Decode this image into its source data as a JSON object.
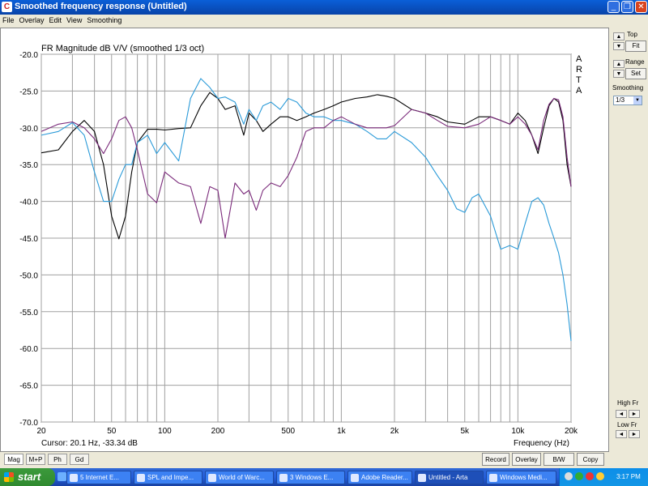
{
  "window": {
    "title": "Smoothed frequency response (Untitled)",
    "icon_glyph": "C",
    "controls": [
      "_",
      "❐",
      "✕"
    ]
  },
  "menu": [
    "File",
    "Overlay",
    "Edit",
    "View",
    "Smoothing"
  ],
  "chart_data": {
    "type": "line",
    "title": "FR Magnitude dB V/V (smoothed 1/3 oct)",
    "xlabel": "Frequency (Hz)",
    "ylabel": "",
    "x_scale": "log",
    "xlim": [
      20,
      20000
    ],
    "ylim": [
      -70,
      -20
    ],
    "y_ticks": [
      "-20.0",
      "-25.0",
      "-30.0",
      "-35.0",
      "-40.0",
      "-45.0",
      "-50.0",
      "-55.0",
      "-60.0",
      "-65.0",
      "-70.0"
    ],
    "x_ticks": [
      "20",
      "50",
      "100",
      "200",
      "500",
      "1k",
      "2k",
      "5k",
      "10k",
      "20k"
    ],
    "side_label": [
      "A",
      "R",
      "T",
      "A"
    ],
    "cursor_text": "Cursor: 20.1 Hz, -33.34 dB",
    "grid": true,
    "colors": {
      "series_black": "#000000",
      "series_blue": "#2a9ad8",
      "series_purple": "#7a2a7a",
      "grid": "#a0a0a0"
    },
    "series": [
      {
        "color": "#000000",
        "x": [
          20,
          25,
          30,
          35,
          40,
          45,
          50,
          55,
          60,
          65,
          70,
          80,
          90,
          100,
          120,
          140,
          160,
          180,
          200,
          220,
          250,
          280,
          300,
          330,
          360,
          400,
          450,
          500,
          560,
          630,
          700,
          800,
          900,
          1000,
          1200,
          1400,
          1600,
          1800,
          2000,
          2500,
          3000,
          3500,
          4000,
          5000,
          6000,
          7000,
          8000,
          9000,
          10000,
          11000,
          12000,
          13000,
          14000,
          15000,
          16000,
          17000,
          18000,
          19000,
          20000
        ],
        "y": [
          -33.4,
          -33,
          -30.5,
          -29,
          -30.5,
          -35,
          -42,
          -45.1,
          -42,
          -36,
          -32,
          -30.2,
          -30.2,
          -30.3,
          -30.1,
          -30.0,
          -27,
          -25.2,
          -26,
          -27.5,
          -27,
          -31,
          -28,
          -29,
          -30.5,
          -29.5,
          -28.5,
          -28.5,
          -29.0,
          -28.5,
          -28.0,
          -27.5,
          -27.0,
          -26.5,
          -26.0,
          -25.8,
          -25.5,
          -25.7,
          -26.0,
          -27.5,
          -28.0,
          -28.5,
          -29.2,
          -29.5,
          -28.5,
          -28.5,
          -29.0,
          -29.5,
          -28.0,
          -29.0,
          -31.0,
          -33.5,
          -30.0,
          -27.0,
          -26.0,
          -26.5,
          -29.0,
          -35.0,
          -38.0
        ]
      },
      {
        "color": "#2a9ad8",
        "x": [
          20,
          25,
          30,
          35,
          40,
          45,
          50,
          55,
          60,
          65,
          70,
          80,
          90,
          100,
          120,
          140,
          160,
          180,
          200,
          220,
          250,
          280,
          300,
          330,
          360,
          400,
          450,
          500,
          560,
          630,
          700,
          800,
          900,
          1000,
          1200,
          1400,
          1600,
          1800,
          2000,
          2500,
          3000,
          3500,
          4000,
          4500,
          5000,
          5500,
          6000,
          7000,
          8000,
          9000,
          10000,
          11000,
          12000,
          13000,
          14000,
          15000,
          16000,
          17000,
          18000,
          19000,
          20000
        ],
        "y": [
          -31,
          -30.5,
          -29.3,
          -31,
          -36,
          -40,
          -40,
          -37,
          -35,
          -35,
          -32,
          -31,
          -33.5,
          -32,
          -34.5,
          -26,
          -23.3,
          -24.5,
          -26,
          -25.8,
          -26.5,
          -29.5,
          -27.5,
          -29.0,
          -27.0,
          -26.5,
          -27.5,
          -26.0,
          -26.5,
          -28.0,
          -28.5,
          -28.5,
          -29.0,
          -29.0,
          -29.5,
          -30.5,
          -31.5,
          -31.5,
          -30.5,
          -32.0,
          -34.0,
          -36.5,
          -38.5,
          -41.0,
          -41.5,
          -39.5,
          -39.0,
          -42.0,
          -46.5,
          -46.0,
          -46.5,
          -43.0,
          -40.0,
          -39.5,
          -40.5,
          -43.0,
          -45.0,
          -47.0,
          -50.0,
          -54.0,
          -59.0
        ]
      },
      {
        "color": "#7a2a7a",
        "x": [
          20,
          25,
          30,
          35,
          40,
          45,
          50,
          55,
          60,
          65,
          70,
          80,
          90,
          100,
          120,
          140,
          160,
          180,
          200,
          220,
          250,
          280,
          300,
          330,
          360,
          400,
          450,
          500,
          560,
          630,
          700,
          800,
          900,
          1000,
          1200,
          1400,
          1600,
          1800,
          2000,
          2500,
          3000,
          3500,
          4000,
          5000,
          6000,
          7000,
          8000,
          9000,
          10000,
          11000,
          12000,
          13000,
          14000,
          15000,
          16000,
          17000,
          18000,
          19000,
          20000
        ],
        "y": [
          -30.5,
          -29.5,
          -29.2,
          -30,
          -31.5,
          -33.5,
          -31.5,
          -29,
          -28.5,
          -30,
          -33,
          -39,
          -40.2,
          -36,
          -37.5,
          -38.0,
          -43,
          -38,
          -38.5,
          -45,
          -37.5,
          -39.0,
          -38.5,
          -41.2,
          -38.5,
          -37.5,
          -38.0,
          -36.5,
          -34.0,
          -30.5,
          -30.0,
          -30.0,
          -29.0,
          -28.5,
          -29.5,
          -30.0,
          -30.0,
          -30.0,
          -29.7,
          -27.5,
          -28.0,
          -29.0,
          -29.8,
          -30.0,
          -29.5,
          -28.5,
          -29.0,
          -29.5,
          -28.5,
          -29.5,
          -31.0,
          -33.0,
          -29.0,
          -26.8,
          -26.0,
          -26.2,
          -28.5,
          -34.0,
          -38.0
        ]
      }
    ]
  },
  "right_panel": {
    "top_label": "Top",
    "fit_label": "Fit",
    "range_label": "Range",
    "set_label": "Set",
    "smoothing_label": "Smoothing",
    "smoothing_value": "1/3",
    "high_fr_label": "High Fr",
    "low_fr_label": "Low Fr",
    "up": "▲",
    "down": "▼",
    "left": "◄",
    "right": "►"
  },
  "bottom": {
    "tabs": [
      "Mag",
      "M+P",
      "Ph",
      "Gd"
    ],
    "buttons": [
      "Record",
      "Overlay",
      "B/W",
      "Copy"
    ]
  },
  "taskbar": {
    "start_label": "start",
    "items": [
      "5 Internet E...",
      "SPL and Impe...",
      "World of Warc...",
      "3 Windows E...",
      "Adobe Reader...",
      "Untitled - Arta",
      "Windows Medi..."
    ],
    "clock": "3:17 PM"
  }
}
